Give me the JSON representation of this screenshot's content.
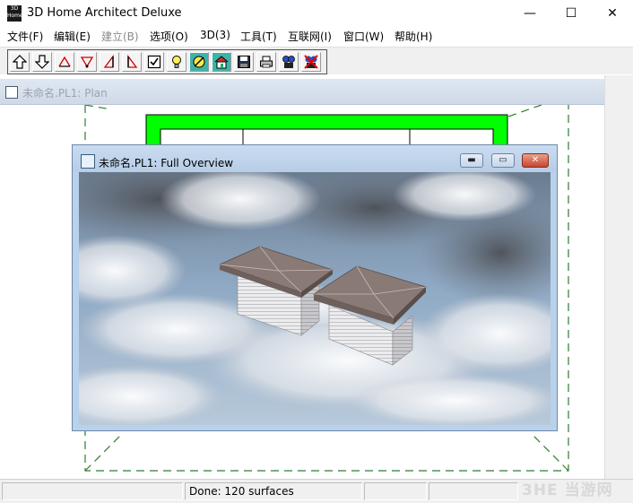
{
  "app": {
    "title": "3D Home Architect Deluxe",
    "icon_text": "3D Home",
    "window_controls": {
      "minimize": "—",
      "maximize": "☐",
      "close": "✕"
    }
  },
  "menu": [
    {
      "label": "文件(F)",
      "disabled": false
    },
    {
      "label": "编辑(E)",
      "disabled": false
    },
    {
      "label": "建立(B)",
      "disabled": true
    },
    {
      "label": "选项(O)",
      "disabled": false
    },
    {
      "label": "3D(3)",
      "disabled": false
    },
    {
      "label": "工具(T)",
      "disabled": false
    },
    {
      "label": "互联网(I)",
      "disabled": false
    },
    {
      "label": "窗口(W)",
      "disabled": false
    },
    {
      "label": "帮助(H)",
      "disabled": false
    }
  ],
  "toolbar": {
    "buttons": [
      {
        "icon": "arrow-up-icon"
      },
      {
        "icon": "arrow-down-icon"
      },
      {
        "icon": "camera-angle-icon"
      },
      {
        "icon": "camera-path-icon"
      },
      {
        "icon": "elevation-icon"
      },
      {
        "icon": "section-icon"
      },
      {
        "icon": "checkbox-icon"
      },
      {
        "icon": "lightbulb-icon"
      },
      {
        "icon": "no-sun-icon"
      },
      {
        "icon": "house-icon"
      },
      {
        "icon": "save-icon"
      },
      {
        "icon": "print-icon"
      },
      {
        "icon": "film-icon"
      },
      {
        "icon": "delete-film-icon"
      }
    ]
  },
  "plan_window": {
    "title": "未命名.PL1: Plan"
  },
  "overview_window": {
    "title": "未命名.PL1: Full Overview",
    "controls": {
      "minimize": "▬",
      "restore": "▭",
      "close": "✕"
    }
  },
  "status": {
    "message": "Done:  120 surfaces"
  },
  "watermark": "3HE 当游网",
  "colors": {
    "plan_wall": "#00ff00",
    "plan_dash": "#2e7d2e",
    "sky": "#8fa9c4",
    "roof": "#8a7a76",
    "siding": "#e8e8ea"
  }
}
